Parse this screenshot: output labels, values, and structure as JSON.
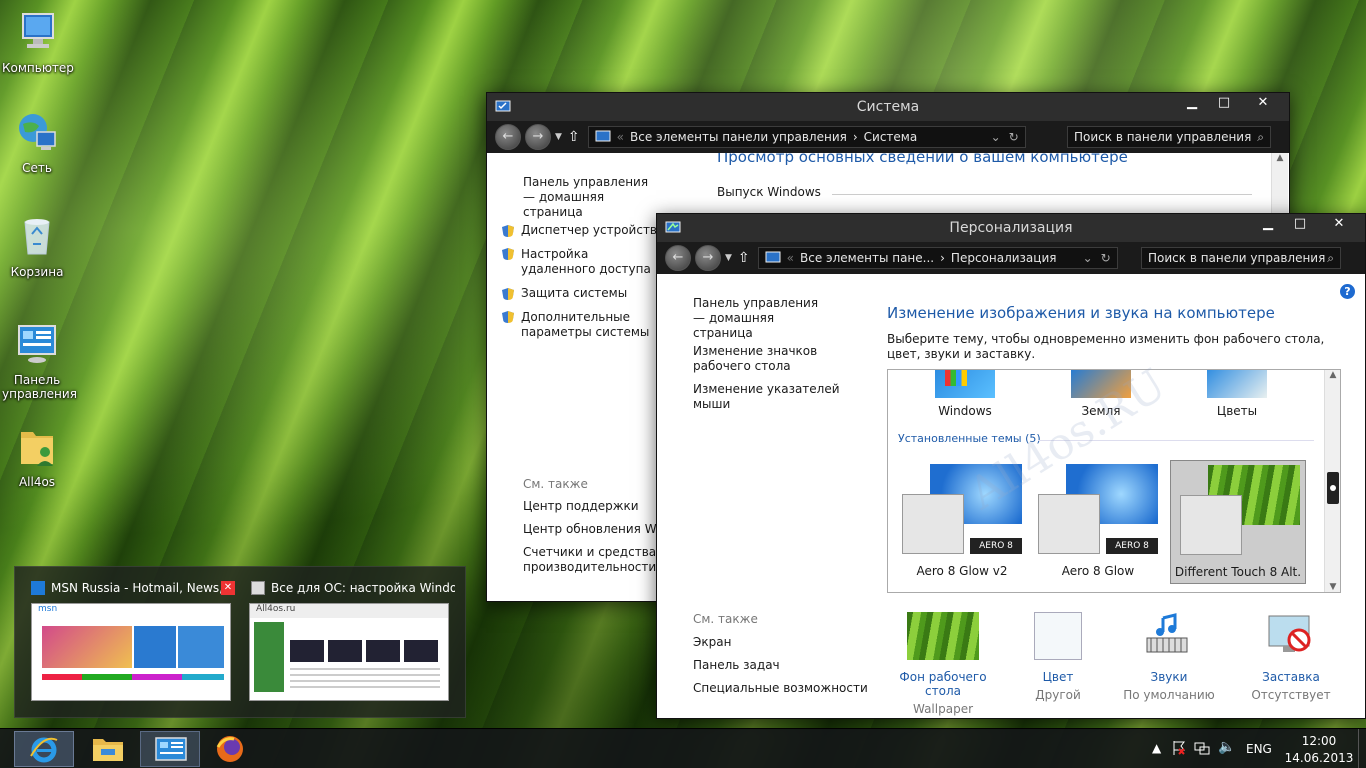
{
  "desktop": {
    "icons": [
      {
        "label": "Компьютер"
      },
      {
        "label": "Сеть"
      },
      {
        "label": "Корзина"
      },
      {
        "label": "Панель\nуправления"
      },
      {
        "label": "All4os"
      }
    ]
  },
  "system_window": {
    "title": "Система",
    "address": {
      "root": "Все элементы панели управления",
      "sep": "›",
      "current": "Система"
    },
    "search_placeholder": "Поиск в панели управления",
    "sidebar": {
      "home": "Панель управления — домашняя страница",
      "links": [
        "Диспетчер устройств",
        "Настройка удаленного доступа",
        "Защита системы",
        "Дополнительные параметры системы"
      ],
      "see_also": "См. также",
      "see_also_links": [
        "Центр поддержки",
        "Центр обновления Windows",
        "Счетчики и средства производительности"
      ]
    },
    "main": {
      "heading": "Просмотр основных сведений о вашем компьютере",
      "section": "Выпуск Windows"
    }
  },
  "personalization_window": {
    "title": "Персонализация",
    "address": {
      "root": "Все элементы пане...",
      "sep": "›",
      "current": "Персонализация"
    },
    "search_placeholder": "Поиск в панели управления",
    "sidebar": {
      "home": "Панель управления — домашняя страница",
      "links": [
        "Изменение значков рабочего стола",
        "Изменение указателей мыши"
      ],
      "see_also": "См. также",
      "see_also_links": [
        "Экран",
        "Панель задач",
        "Специальные возможности"
      ]
    },
    "main": {
      "heading": "Изменение изображения и звука на компьютере",
      "description": "Выберите тему, чтобы одновременно изменить фон рабочего стола, цвет, звуки и заставку.",
      "default_themes": [
        "Windows",
        "Земля",
        "Цветы"
      ],
      "installed_header": "Установленные темы (5)",
      "installed_themes": [
        {
          "name": "Aero 8 Glow v2",
          "badge": "AERO 8"
        },
        {
          "name": "Aero 8 Glow",
          "badge": "AERO 8"
        },
        {
          "name": "Different Touch 8 Alt.",
          "badge": ""
        }
      ],
      "bottom": [
        {
          "title": "Фон рабочего стола",
          "sub": "Wallpaper"
        },
        {
          "title": "Цвет",
          "sub": "Другой"
        },
        {
          "title": "Звуки",
          "sub": "По умолчанию"
        },
        {
          "title": "Заставка",
          "sub": "Отсутствует"
        }
      ]
    },
    "watermark": "All4os.RU"
  },
  "thumbnails": [
    {
      "title": "MSN Russia - Hotmail, News, Cr...",
      "site": "msn"
    },
    {
      "title": "Все для ОС: настройка Windo...",
      "site": "All4os.ru"
    }
  ],
  "taskbar": {
    "lang": "ENG",
    "time": "12:00",
    "date": "14.06.2013"
  },
  "colors": {
    "window_frame": "#2b2b2b",
    "link_blue": "#1e5aa8"
  }
}
